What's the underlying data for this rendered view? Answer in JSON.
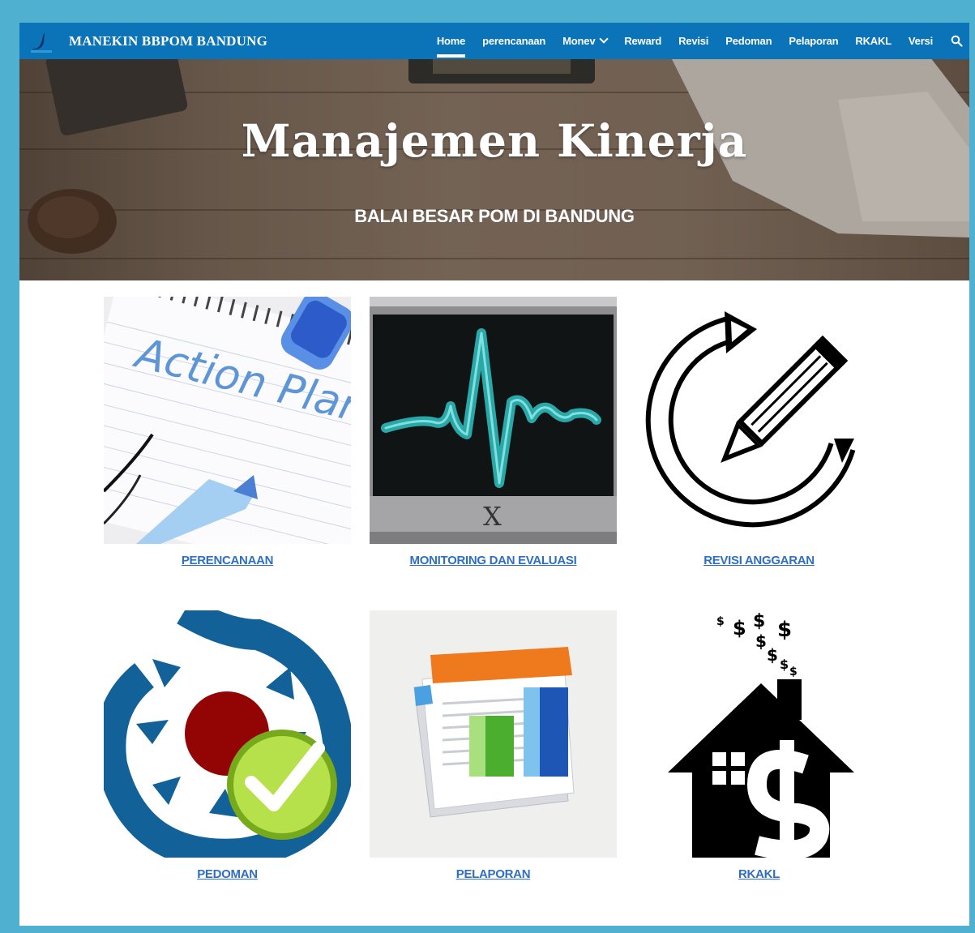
{
  "header": {
    "site_title": "MANEKIN BBPOM BANDUNG",
    "nav": [
      {
        "label": "Home",
        "active": true
      },
      {
        "label": "perencanaan"
      },
      {
        "label": "Monev",
        "has_dropdown": true
      },
      {
        "label": "Reward"
      },
      {
        "label": "Revisi"
      },
      {
        "label": "Pedoman"
      },
      {
        "label": "Pelaporan"
      },
      {
        "label": "RKAKL"
      },
      {
        "label": "Versi"
      }
    ],
    "search_icon": "search-icon"
  },
  "hero": {
    "title": "Manajemen Kinerja",
    "subtitle": "BALAI BESAR POM DI BANDUNG"
  },
  "cards": [
    {
      "label": "PERENCANAAN",
      "image_text": "Action Plan",
      "icon": "action-plan-image"
    },
    {
      "label": "MONITORING DAN EVALUASI",
      "icon": "heartbeat-monitor-image"
    },
    {
      "label": "REVISI ANGGARAN",
      "icon": "revise-pencil-image"
    },
    {
      "label": "PEDOMAN",
      "icon": "guideline-checkmark-image"
    },
    {
      "label": "PELAPORAN",
      "icon": "report-chart-image"
    },
    {
      "label": "RKAKL",
      "icon": "money-house-image"
    }
  ],
  "colors": {
    "frame": "#4fb0cf",
    "topbar": "#0b73b7",
    "link": "#2f6fc2"
  }
}
